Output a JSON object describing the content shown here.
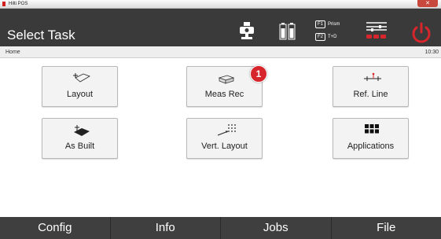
{
  "window": {
    "app_title": "Hilti POS",
    "close_label": "✕"
  },
  "header": {
    "title": "Select Task",
    "f1_key": "F1",
    "f1_label": "Prism",
    "f2_key": "F2",
    "f2_label": "T+D",
    "icons": [
      "instrument-icon",
      "battery-icon",
      "settings-sliders-icon",
      "power-icon"
    ],
    "accent_color": "#d6262b"
  },
  "status": {
    "breadcrumb": "Home",
    "clock": "10:30"
  },
  "tiles": [
    {
      "label": "Layout",
      "icon": "layout-icon"
    },
    {
      "label": "Meas Rec",
      "icon": "measure-record-icon"
    },
    {
      "label": "Ref. Line",
      "icon": "reference-line-icon"
    },
    {
      "label": "As Built",
      "icon": "as-built-icon"
    },
    {
      "label": "Vert. Layout",
      "icon": "vertical-layout-icon"
    },
    {
      "label": "Applications",
      "icon": "applications-grid-icon"
    }
  ],
  "badge": "1",
  "bottom_nav": [
    "Config",
    "Info",
    "Jobs",
    "File"
  ]
}
